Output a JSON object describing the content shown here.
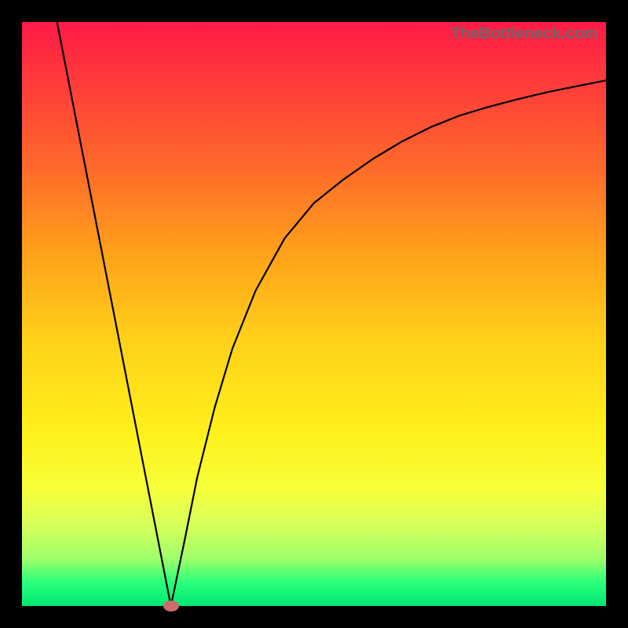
{
  "watermark": "TheBottleneck.com",
  "chart_data": {
    "type": "line",
    "title": "",
    "xlabel": "",
    "ylabel": "",
    "xlim": [
      0,
      100
    ],
    "ylim": [
      0,
      100
    ],
    "grid": false,
    "legend": false,
    "series": [
      {
        "name": "left-segment",
        "x": [
          6,
          25.5
        ],
        "y": [
          100,
          0
        ]
      },
      {
        "name": "right-curve",
        "x": [
          25.5,
          28,
          30,
          33,
          36,
          40,
          45,
          50,
          55,
          60,
          65,
          70,
          75,
          80,
          85,
          90,
          95,
          100
        ],
        "y": [
          0,
          12,
          22,
          34,
          44,
          54,
          63,
          69,
          73,
          76.5,
          79.5,
          82,
          84,
          85.5,
          86.8,
          88,
          89,
          90
        ]
      }
    ],
    "marker": {
      "x": 25.5,
      "y": 0,
      "color": "#cc6b6b"
    },
    "background_gradient": {
      "top": "#ff1a47",
      "bottom": "#00e873"
    }
  }
}
